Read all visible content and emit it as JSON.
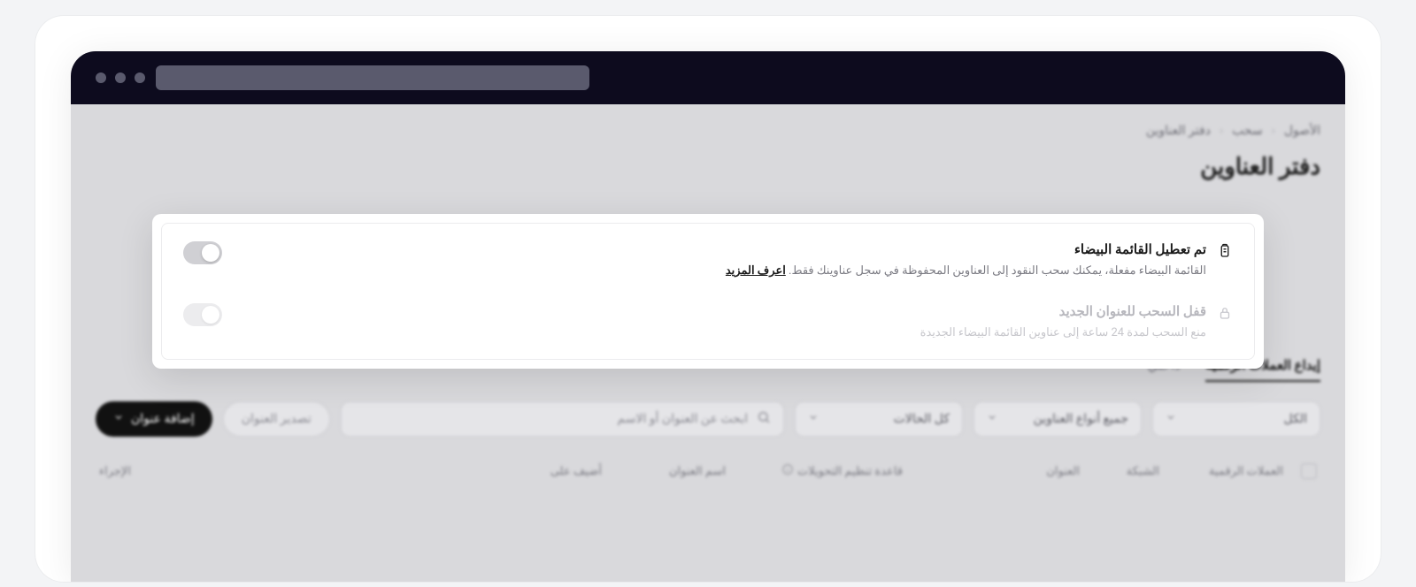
{
  "breadcrumb": {
    "item1": "الأصول",
    "item2": "سحب",
    "item3": "دفتر العناوين"
  },
  "page_title": "دفتر العناوين",
  "card": {
    "row1": {
      "title": "تم تعطيل القائمة البيضاء",
      "desc": "القائمة البيضاء مفعلة، يمكنك سحب النقود إلى العناوين المحفوظة في سجل عناوينك فقط.",
      "link": "اعرف المزيد"
    },
    "row2": {
      "title": "قفل السحب للعنوان الجديد",
      "desc": "منع السحب لمدة 24 ساعة إلى عناوين القائمة البيضاء الجديدة"
    }
  },
  "tabs": {
    "t1": "إيداع العملات الرقمية",
    "t2": "داخلي"
  },
  "filters": {
    "all": "الكل",
    "all_types": "جميع أنواع العناوين",
    "all_status": "كل الحالات",
    "search_placeholder": "ابحث عن العنوان أو الاسم",
    "export": "تصدير العنوان",
    "add": "إضافة عنوان"
  },
  "table": {
    "h1": "العملات الرقمية",
    "h2": "الشبكة",
    "h3": "العنوان",
    "h4": "قاعدة تنظيم التحويلات",
    "h5": "اسم العنوان",
    "h6": "أضيف على",
    "h7": "الإجراء"
  }
}
